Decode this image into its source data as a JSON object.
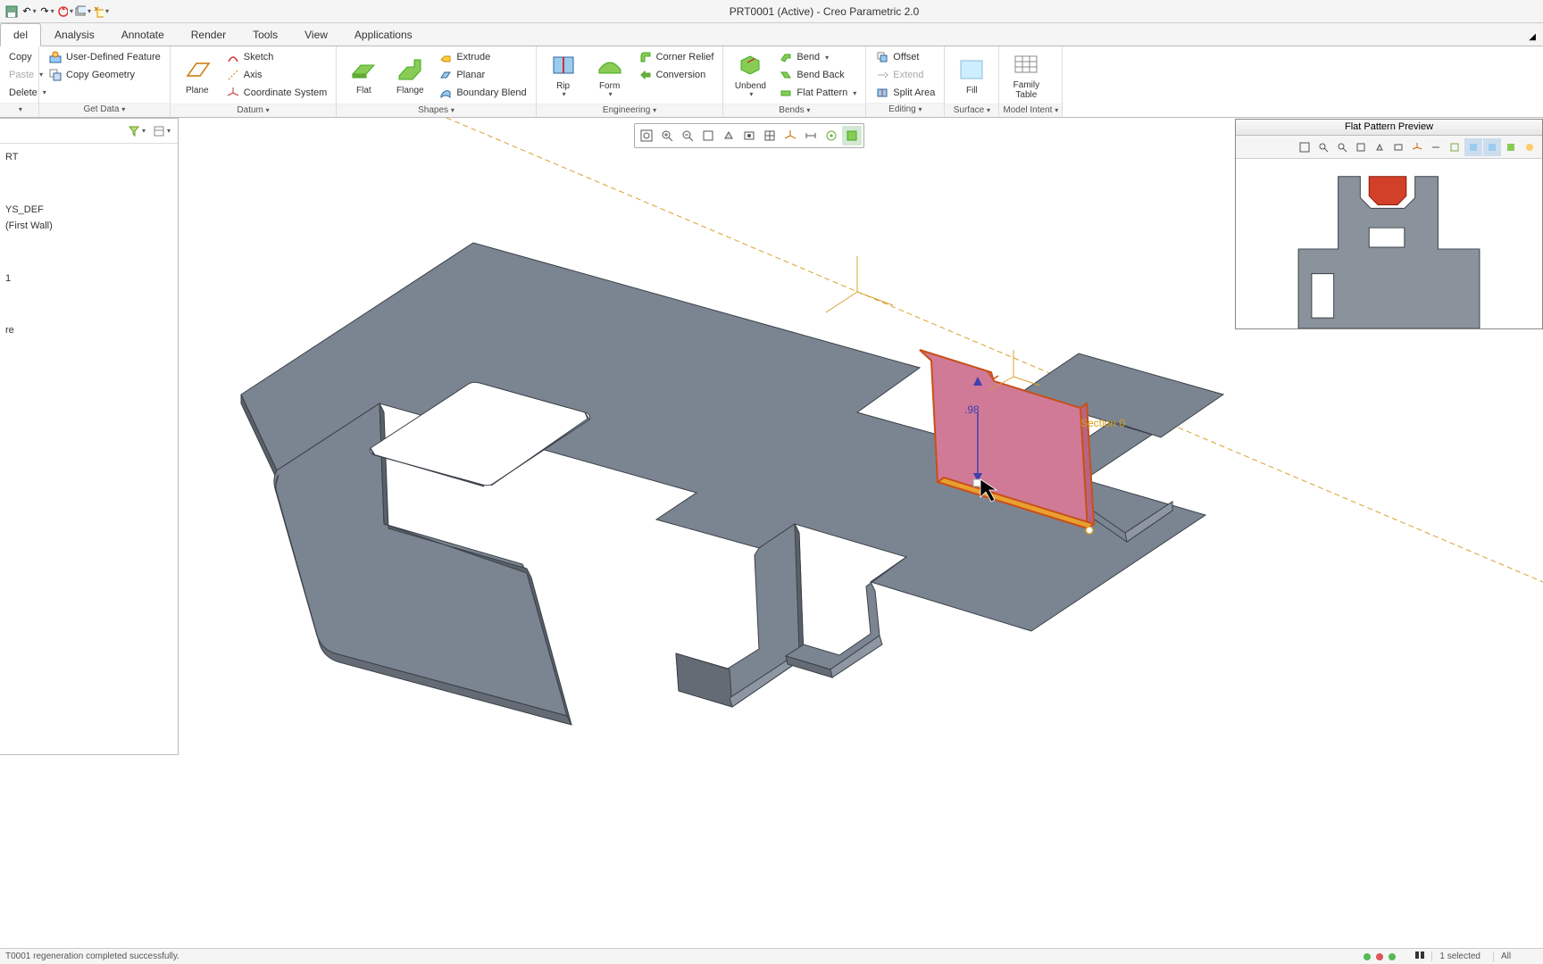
{
  "title": "PRT0001 (Active) - Creo Parametric 2.0",
  "tabs": {
    "model": "del",
    "analysis": "Analysis",
    "annotate": "Annotate",
    "render": "Render",
    "tools": "Tools",
    "view": "View",
    "applications": "Applications"
  },
  "ribbon": {
    "clipboard": {
      "copy": "Copy",
      "paste": "Paste",
      "delete": "Delete",
      "label": ""
    },
    "getdata": {
      "udf": "User-Defined Feature",
      "copygeom": "Copy Geometry",
      "label": "Get Data"
    },
    "datum": {
      "plane": "Plane",
      "axis": "Axis",
      "csys": "Coordinate System",
      "sketch": "Sketch",
      "label": "Datum"
    },
    "shapes": {
      "flat": "Flat",
      "flange": "Flange",
      "extrude": "Extrude",
      "planar": "Planar",
      "boundary": "Boundary Blend",
      "label": "Shapes"
    },
    "engineering": {
      "rip": "Rip",
      "form": "Form",
      "corner": "Corner Relief",
      "conversion": "Conversion",
      "label": "Engineering"
    },
    "bends": {
      "unbend": "Unbend",
      "bend": "Bend",
      "bendback": "Bend Back",
      "flatpattern": "Flat Pattern",
      "label": "Bends"
    },
    "editing": {
      "offset": "Offset",
      "extend": "Extend",
      "split": "Split Area",
      "label": "Editing"
    },
    "surface": {
      "fill": "Fill",
      "label": "Surface"
    },
    "modelintent": {
      "family": "Family\nTable",
      "label": "Model Intent"
    }
  },
  "tree": {
    "root": "RT",
    "csys": "YS_DEF",
    "firstwall": "(First Wall)",
    "item1": "1",
    "itemhere": "re"
  },
  "preview": {
    "title": "Flat Pattern Preview"
  },
  "dimension": {
    "value": ".98",
    "section": "Section 0"
  },
  "status": {
    "message": "T0001 regeneration completed successfully.",
    "selected": "1 selected",
    "filter": "All"
  }
}
